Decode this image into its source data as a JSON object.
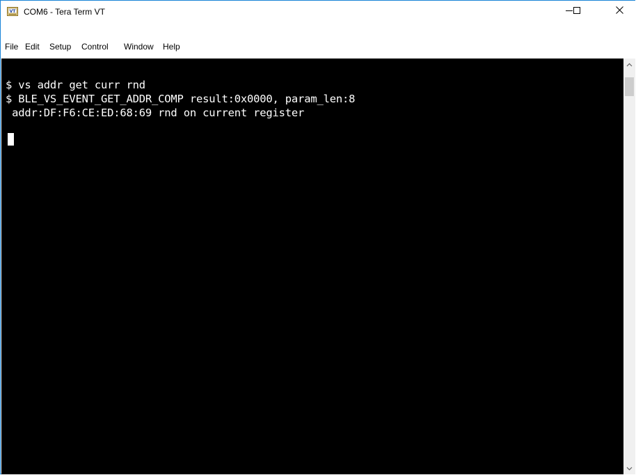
{
  "window": {
    "title": "COM6 - Tera Term VT",
    "app_icon": "tera-term-vt-icon",
    "app_icon_text": "VT",
    "controls": {
      "minimize_icon": "minimize-icon",
      "maximize_icon": "maximize-icon",
      "close_icon": "close-icon"
    }
  },
  "menu": {
    "items": [
      {
        "label": "File"
      },
      {
        "label": "Edit"
      },
      {
        "label": "Setup"
      },
      {
        "label": "Control"
      },
      {
        "label": "Window"
      },
      {
        "label": "Help"
      }
    ]
  },
  "terminal": {
    "background": "#000000",
    "foreground": "#ffffff",
    "lines": [
      "$ vs addr get curr rnd",
      "$ BLE_VS_EVENT_GET_ADDR_COMP result:0x0000, param_len:8",
      " addr:DF:F6:CE:ED:68:69 rnd on current register"
    ]
  },
  "scrollbar": {
    "up_icon": "scroll-up-arrow-icon",
    "down_icon": "scroll-down-arrow-icon"
  },
  "colors": {
    "window_border": "#1883d7",
    "scrollbar_track": "#f0f0f0",
    "scrollbar_thumb": "#cdcdcd"
  }
}
